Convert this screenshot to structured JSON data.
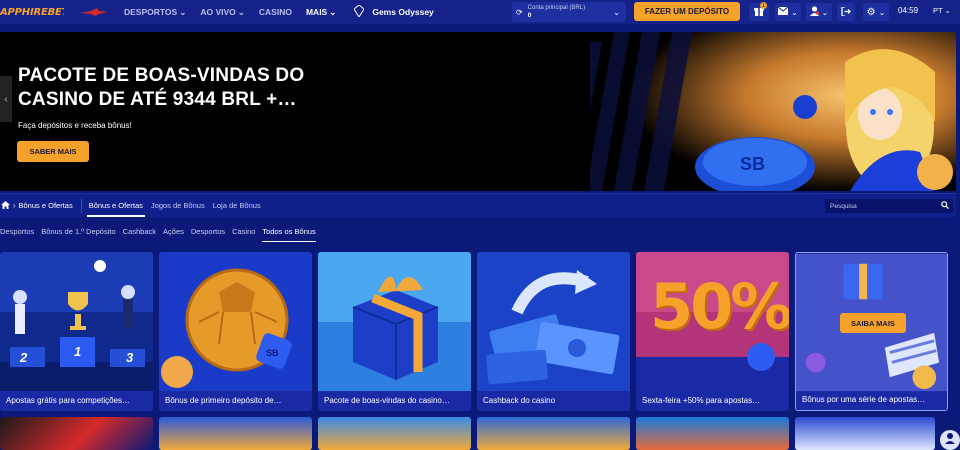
{
  "header": {
    "logo": "APPHIREBET",
    "nav": [
      "DESPORTOS",
      "AO VIVO",
      "CASINO",
      "MAIS"
    ],
    "game_name": "Gems Odyssey",
    "account_label": "Conta principal (BRL)",
    "account_balance": "0",
    "deposit_label": "FAZER UM DEPÓSITO",
    "gift_badge": "1",
    "time": "04:59",
    "language": "PT"
  },
  "hero": {
    "title": "PACOTE DE BOAS-VINDAS DO CASINO DE ATÉ 9344 BRL +…",
    "subtitle": "Faça depósitos e receba bônus!",
    "button": "SABER MAIS"
  },
  "subnav": {
    "crumb": "Bônus e Ofertas",
    "tabs": [
      "Bônus e Ofertas",
      "Jogos de Bônus",
      "Loja de Bônus"
    ],
    "search_placeholder": "Pesquisa"
  },
  "filters": [
    "Desportos",
    "Bônus de 1.º Depósito",
    "Cashback",
    "Ações",
    "Desportos",
    "Casino",
    "Todos os Bônus"
  ],
  "cards": [
    {
      "label": "Apostas grátis para competições…",
      "numbers": [
        "2",
        "1",
        "3"
      ]
    },
    {
      "label": "Bônus de primeiro depósito de…"
    },
    {
      "label": "Pacote de boas-vindas do casino…"
    },
    {
      "label": "Cashback do casino"
    },
    {
      "label": "Sexta-feira +50% para apostas…",
      "big_text": "50%"
    },
    {
      "label": "Bônus por uma série de apostas…",
      "hover_button": "SAIBA MAIS"
    }
  ],
  "colors": {
    "background": "#0b1a78",
    "accent": "#f6a12a",
    "card": "#1a2aa5"
  }
}
